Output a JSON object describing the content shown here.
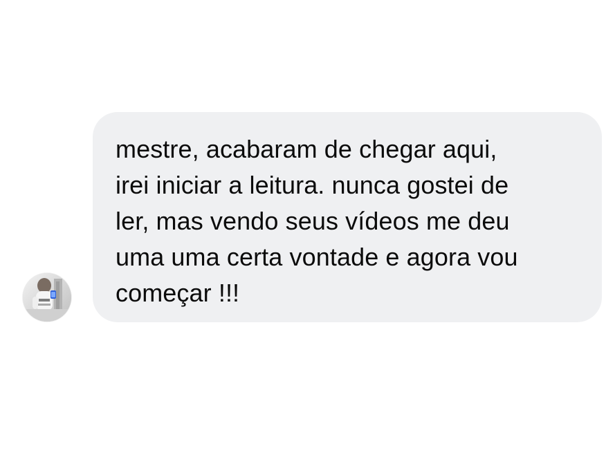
{
  "conversation": {
    "avatar": {
      "icon": "profile-photo-icon"
    },
    "message": {
      "lines": [
        "mestre, acabaram de chegar aqui,",
        "irei iniciar a leitura. nunca gostei de",
        "ler, mas vendo seus vídeos me deu",
        "uma uma certa vontade e agora vou",
        "começar !!!"
      ]
    }
  },
  "colors": {
    "background": "#ffffff",
    "bubble": "#eff0f2",
    "text": "#0b0b0b"
  }
}
